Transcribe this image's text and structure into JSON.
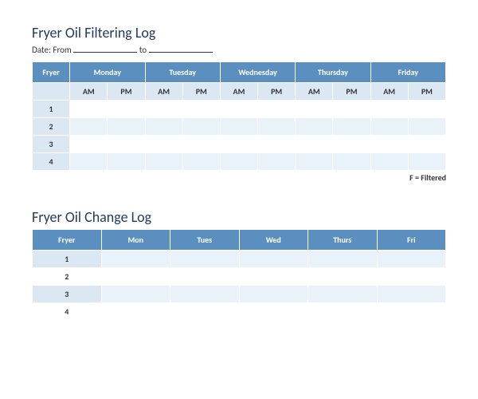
{
  "filtering": {
    "title": "Fryer Oil Filtering Log",
    "date_prefix": "Date: From",
    "date_middle": "to",
    "headers": [
      "Fryer",
      "Monday",
      "Tuesday",
      "Wednesday",
      "Thursday",
      "Friday"
    ],
    "subheaders": [
      "AM",
      "PM",
      "AM",
      "PM",
      "AM",
      "PM",
      "AM",
      "PM",
      "AM",
      "PM"
    ],
    "rows": [
      "1",
      "2",
      "3",
      "4"
    ],
    "legend": "F = Filtered"
  },
  "change": {
    "title": "Fryer Oil Change Log",
    "headers": [
      "Fryer",
      "Mon",
      "Tues",
      "Wed",
      "Thurs",
      "Fri"
    ],
    "rows": [
      "1",
      "2",
      "3",
      "4"
    ]
  }
}
